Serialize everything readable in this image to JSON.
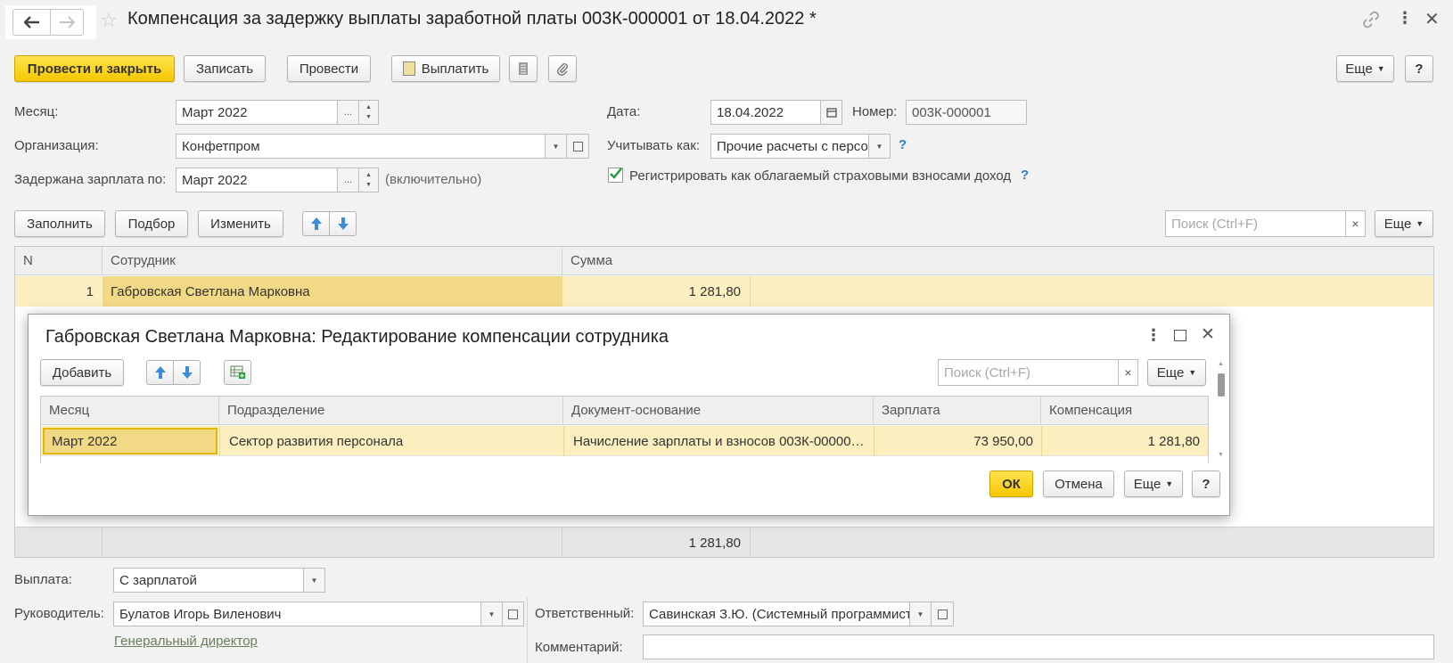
{
  "window": {
    "title": "Компенсация за задержку выплаты заработной платы 003К-000001 от 18.04.2022 *",
    "back_icon": "arrow-left-icon",
    "forward_icon": "arrow-right-icon"
  },
  "toolbar": {
    "post_close": "Провести и закрыть",
    "save": "Записать",
    "post": "Провести",
    "pay": "Выплатить",
    "more": "Еще",
    "help": "?"
  },
  "header": {
    "month_label": "Месяц:",
    "month_value": "Март 2022",
    "org_label": "Организация:",
    "org_value": "Конфетпром",
    "delayed_label": "Задержана зарплата по:",
    "delayed_value": "Март 2022",
    "delayed_note": "(включительно)",
    "date_label": "Дата:",
    "date_value": "18.04.2022",
    "number_label": "Номер:",
    "number_value": "003К-000001",
    "account_label": "Учитывать как:",
    "account_value": "Прочие расчеты с персо",
    "register_checkbox": "Регистрировать как облагаемый страховыми взносами доход",
    "register_checked": true,
    "dots": "..."
  },
  "table_toolbar": {
    "fill": "Заполнить",
    "select": "Подбор",
    "change": "Изменить",
    "search_placeholder": "Поиск (Ctrl+F)",
    "clear": "×",
    "more": "Еще"
  },
  "main_table": {
    "columns": [
      "N",
      "Сотрудник",
      "Сумма"
    ],
    "rows": [
      {
        "n": "1",
        "employee": "Габровская Светлана Марковна",
        "sum": "1 281,80"
      }
    ],
    "total": "1 281,80"
  },
  "dialog": {
    "title": "Габровская Светлана Марковна: Редактирование компенсации сотрудника",
    "add": "Добавить",
    "search_placeholder": "Поиск (Ctrl+F)",
    "clear": "×",
    "more": "Еще",
    "columns": [
      "Месяц",
      "Подразделение",
      "Документ-основание",
      "Зарплата",
      "Компенсация"
    ],
    "rows": [
      {
        "month": "Март 2022",
        "department": "Сектор развития персонала",
        "document": "Начисление зарплаты и взносов 003К-00000…",
        "salary": "73 950,00",
        "compensation": "1 281,80"
      }
    ],
    "ok": "ОК",
    "cancel": "Отмена",
    "help": "?"
  },
  "footer": {
    "payment_label": "Выплата:",
    "payment_value": "С зарплатой",
    "manager_label": "Руководитель:",
    "manager_value": "Булатов Игорь Виленович",
    "manager_position": "Генеральный директор ",
    "responsible_label": "Ответственный:",
    "responsible_value": "Савинская З.Ю. (Системный программист",
    "comment_label": "Комментарий:",
    "comment_value": ""
  },
  "colors": {
    "accent_yellow": "#f5c800",
    "row_highlight": "#fbefc0",
    "selected_cell": "#f1d985",
    "help_blue": "#2f7ec7"
  }
}
